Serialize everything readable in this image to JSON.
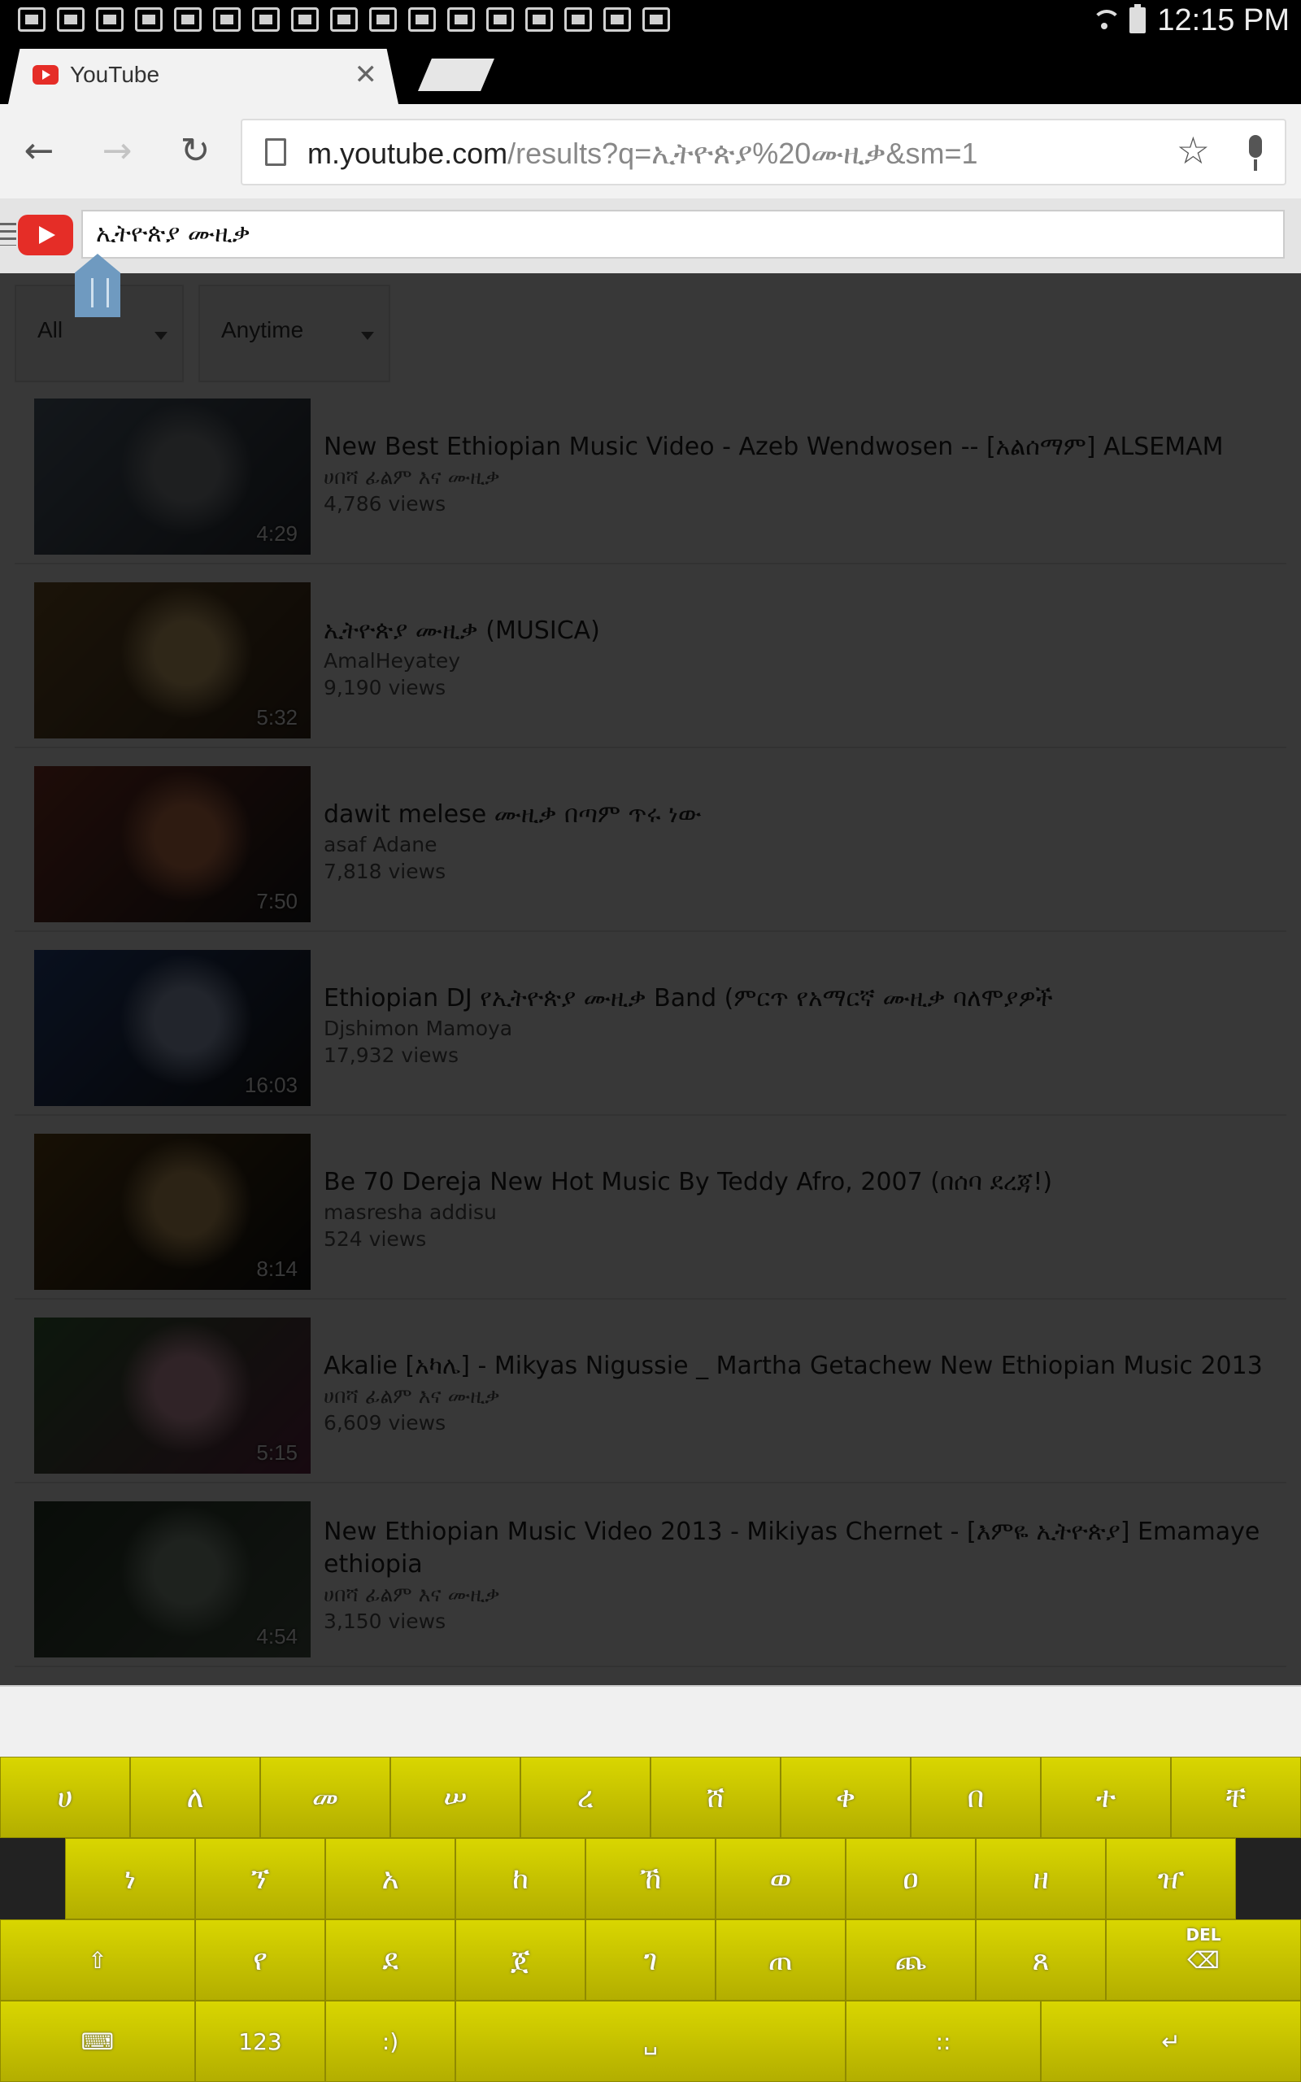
{
  "status_bar": {
    "notification_icons": [
      "gallery-icon",
      "mail-icon",
      "mail-icon",
      "mail-icon",
      "mail-icon",
      "clapper-icon",
      "nyt-icon",
      "nyt-icon",
      "bird-icon",
      "download-icon",
      "share-icon",
      "keyboard-icon",
      "battery-100-icon",
      "message-icon",
      "briefcase-icon",
      "briefcase-icon",
      "compass-icon"
    ],
    "time": "12:15 PM"
  },
  "browser": {
    "tab_title": "YouTube",
    "url_host": "m.youtube.com",
    "url_path": "/results?q=ኢትዮጵያ%20ሙዚቃ&sm=1"
  },
  "youtube": {
    "search_text": "ኢትዮጵያ ሙዚቃ",
    "filters": {
      "type": "All",
      "time": "Anytime"
    },
    "results": [
      {
        "title": "New Best Ethiopian Music Video - Azeb Wendwosen -- [አልሰማም] ALSEMAM",
        "channel": "ሀበሻ ፊልም እና ሙዚቃ",
        "views": "4,786 views",
        "duration": "4:29",
        "thumb_colors": [
          "#5a6b7c",
          "#2b2f36",
          "#8a8f94"
        ]
      },
      {
        "title": "ኢትዮጵያ ሙዚቃ (MUSICA)",
        "channel": "AmalHeyatey",
        "views": "9,190 views",
        "duration": "5:32",
        "thumb_colors": [
          "#7a5a2a",
          "#3a2a1a",
          "#d4b070"
        ]
      },
      {
        "title": "dawit melese ሙዚቃ በጣም ጥሩ ነው",
        "channel": "asaf Adane",
        "views": "7,818 views",
        "duration": "7:50",
        "thumb_colors": [
          "#8a3a2a",
          "#1a1a1a",
          "#d07a50"
        ]
      },
      {
        "title": "Ethiopian DJ የኢትዮጵያ ሙዚቃ Band (ምርጥ የአማርኛ ሙዚቃ ባለሞያዎች",
        "channel": "Djshimon Mamoya",
        "views": "17,932 views",
        "duration": "16:03",
        "thumb_colors": [
          "#2a4a8a",
          "#1a1a1a",
          "#9aa8c8"
        ]
      },
      {
        "title": "Be 70 Dereja New Hot Music By Teddy Afro, 2007 (በሰባ ደረጃ!)",
        "channel": "masresha addisu",
        "views": "524 views",
        "duration": "8:14",
        "thumb_colors": [
          "#6a4a1a",
          "#111111",
          "#c8a060"
        ]
      },
      {
        "title": "Akalie [አካሌ] - Mikyas Nigussie _ Martha Getachew New Ethiopian Music 2013",
        "channel": "ሀበሻ ፊልም እና ሙዚቃ",
        "views": "6,609 views",
        "duration": "5:15",
        "thumb_colors": [
          "#3a6a3a",
          "#6a2a4a",
          "#d8a0b0"
        ]
      },
      {
        "title": "New Ethiopian Music Video 2013 - Mikiyas Chernet - [እምዬ ኢትዮጵያ] Emamaye ethiopia",
        "channel": "ሀበሻ ፊልም እና ሙዚቃ",
        "views": "3,150 views",
        "duration": "4:54",
        "thumb_colors": [
          "#2a3a2a",
          "#4a5a4a",
          "#8a9a8a"
        ]
      }
    ]
  },
  "keyboard": {
    "row1": [
      "ሀ",
      "ለ",
      "መ",
      "ሠ",
      "ረ",
      "ሸ",
      "ቀ",
      "በ",
      "ተ",
      "ቸ"
    ],
    "row2": [
      "ነ",
      "ኘ",
      "አ",
      "ከ",
      "ኸ",
      "ወ",
      "ዐ",
      "ዘ",
      "ዠ"
    ],
    "row3": [
      "shift-icon",
      "የ",
      "ደ",
      "ጀ",
      "ገ",
      "ጠ",
      "ጨ",
      "ጸ",
      "delete-icon"
    ],
    "row4": [
      "keyboard-settings-icon",
      "123",
      ":)",
      "space-icon",
      "::",
      "enter-icon"
    ],
    "delete_label": "DEL"
  },
  "colors": {
    "keyboard_key": "#c8c400",
    "youtube_red": "#e52d27",
    "overlay": "rgba(0,0,0,0.78)"
  }
}
